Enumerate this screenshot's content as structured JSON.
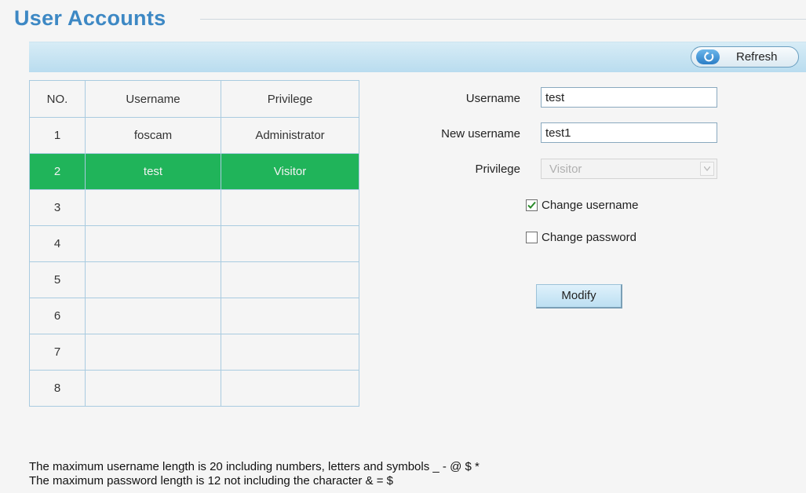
{
  "page": {
    "title": "User Accounts"
  },
  "toolbar": {
    "refresh_label": "Refresh",
    "refresh_icon": "refresh-icon"
  },
  "table": {
    "headers": [
      "NO.",
      "Username",
      "Privilege"
    ],
    "rows": [
      {
        "no": "1",
        "username": "foscam",
        "privilege": "Administrator",
        "selected": false
      },
      {
        "no": "2",
        "username": "test",
        "privilege": "Visitor",
        "selected": true
      },
      {
        "no": "3",
        "username": "",
        "privilege": "",
        "selected": false
      },
      {
        "no": "4",
        "username": "",
        "privilege": "",
        "selected": false
      },
      {
        "no": "5",
        "username": "",
        "privilege": "",
        "selected": false
      },
      {
        "no": "6",
        "username": "",
        "privilege": "",
        "selected": false
      },
      {
        "no": "7",
        "username": "",
        "privilege": "",
        "selected": false
      },
      {
        "no": "8",
        "username": "",
        "privilege": "",
        "selected": false
      }
    ]
  },
  "form": {
    "username_label": "Username",
    "username_value": "test",
    "new_username_label": "New username",
    "new_username_value": "test1",
    "privilege_label": "Privilege",
    "privilege_value": "Visitor",
    "change_username_label": "Change username",
    "change_username_checked": true,
    "change_password_label": "Change password",
    "change_password_checked": false,
    "modify_label": "Modify"
  },
  "notes": {
    "username_rule": "The maximum username length is 20 including numbers, letters and symbols _ - @ $ *",
    "password_rule": "The maximum password length is 12 not including the character & = $"
  },
  "colors": {
    "accent": "#3d88c4",
    "selected_row": "#20b45a",
    "toolbar": "#c6e3f2"
  }
}
